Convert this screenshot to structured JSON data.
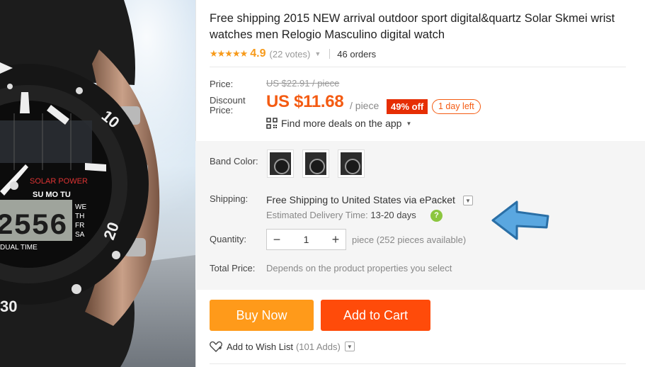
{
  "product": {
    "title": "Free shipping 2015 NEW arrival outdoor sport digital&quartz Solar Skmei wrist watches men Relogio Masculino digital watch",
    "image": {
      "watch_text_solar": "SOLAR POWER",
      "watch_text_days": "SU MO TU",
      "watch_text_dual": "DUAL TIME",
      "watch_digits": "2556",
      "watch_weekdays": [
        "WE",
        "TH",
        "FR",
        "SA"
      ],
      "bezel_numbers": [
        "10",
        "20",
        "30"
      ]
    }
  },
  "rating": {
    "stars": "★★★★★",
    "score": "4.9",
    "votes": "(22 votes)",
    "orders": "46 orders"
  },
  "price": {
    "label": "Price:",
    "original": "US $22.91 / piece",
    "discount_label_line1": "Discount",
    "discount_label_line2": "Price:",
    "discount_value": "US $11.68",
    "per_unit": "/ piece",
    "off_badge": "49% off",
    "time_left": "1 day left",
    "app_deals": "Find more deals on the app"
  },
  "options": {
    "band_color_label": "Band Color:",
    "band_colors": [
      "black-white",
      "black-copper",
      "black-silver"
    ],
    "shipping_label": "Shipping:",
    "shipping_text": "Free Shipping to United States via ePacket",
    "delivery_label": "Estimated Delivery Time:",
    "delivery_days": "13-20 days",
    "quantity_label": "Quantity:",
    "quantity_value": "1",
    "quantity_avail": "piece (252 pieces available)",
    "total_label": "Total Price:",
    "total_note": "Depends on the product properties you select"
  },
  "actions": {
    "buy_now": "Buy Now",
    "add_to_cart": "Add to Cart",
    "wish_list": "Add to Wish List",
    "wish_count": "(101 Adds)"
  },
  "colors": {
    "price_orange": "#f45b12",
    "badge_red": "#e62e04",
    "buy_now": "#ff9a1a",
    "add_to_cart": "#ff4b0a",
    "star": "#f79a1a",
    "arrow_blue": "#5aa7e0"
  }
}
